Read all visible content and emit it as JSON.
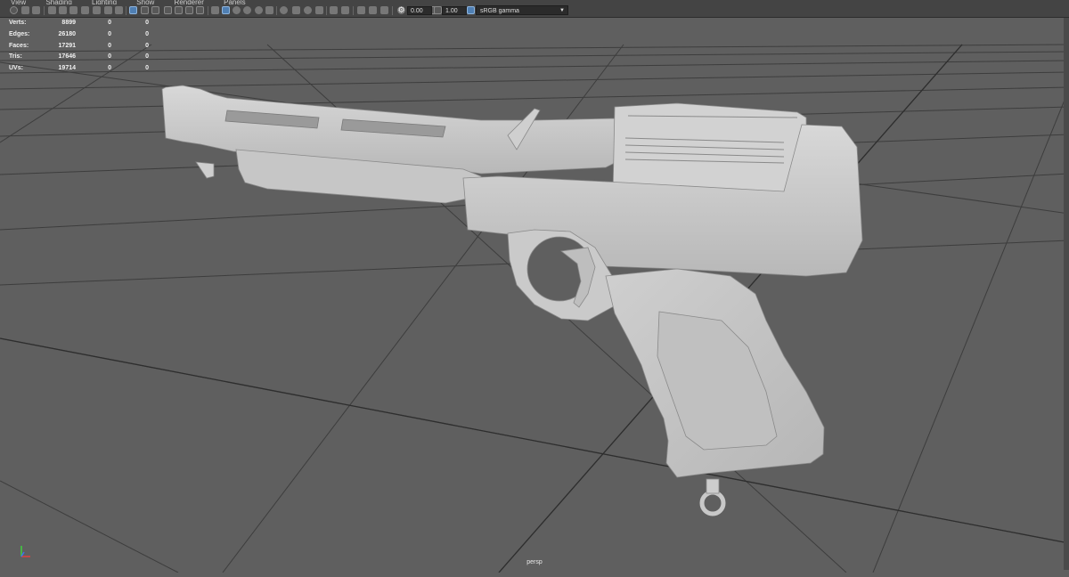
{
  "menubar": {
    "items": [
      "View",
      "Shading",
      "Lighting",
      "Show",
      "Renderer",
      "Panels"
    ]
  },
  "toolbar": {
    "exposure": "0.00",
    "gamma": "1.00",
    "color_space": "sRGB gamma"
  },
  "hud": {
    "rows": [
      {
        "label": "Verts:",
        "value": "8899",
        "sel": "0",
        "comp": "0"
      },
      {
        "label": "Edges:",
        "value": "26180",
        "sel": "0",
        "comp": "0"
      },
      {
        "label": "Faces:",
        "value": "17291",
        "sel": "0",
        "comp": "0"
      },
      {
        "label": "Tris:",
        "value": "17646",
        "sel": "0",
        "comp": "0"
      },
      {
        "label": "UVs:",
        "value": "19714",
        "sel": "0",
        "comp": "0"
      }
    ]
  },
  "viewport": {
    "camera": "persp",
    "model": "pistol-mesh",
    "background_color": "#5f5f5f",
    "model_color": "#c9c9c9"
  },
  "icons": {
    "axis": "xyz-axis-icon",
    "color_space_dropdown": "chevron-down-icon"
  }
}
